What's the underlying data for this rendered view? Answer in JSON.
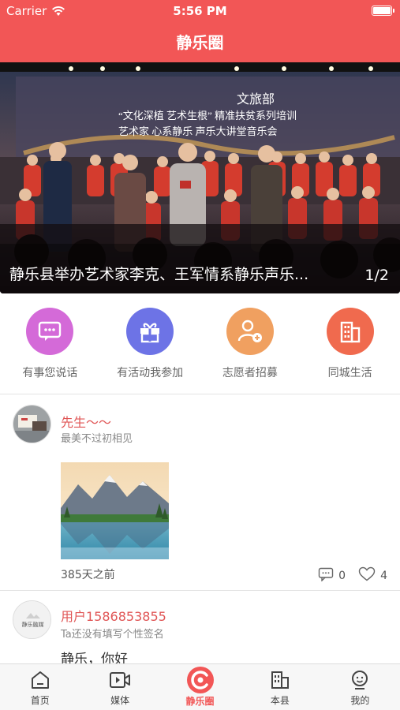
{
  "status_bar": {
    "carrier": "Carrier",
    "time": "5:56 PM"
  },
  "header": {
    "title": "静乐圈"
  },
  "banner": {
    "caption": "静乐县举办艺术家李克、王军情系静乐声乐...",
    "pager": "1/2",
    "backdrop": {
      "sign": "文旅部",
      "line1": "“文化深植  艺术生根” 精准扶贫系列培训",
      "line2": "艺术家    心系静乐    声乐大讲堂音乐会"
    }
  },
  "menu": [
    {
      "label": "有事您说话",
      "icon": "chat-icon",
      "color": "#d46ad8"
    },
    {
      "label": "有活动我参加",
      "icon": "gift-icon",
      "color": "#6d73e6"
    },
    {
      "label": "志愿者招募",
      "icon": "volunteer-icon",
      "color": "#f0a060"
    },
    {
      "label": "同城生活",
      "icon": "building-icon",
      "color": "#f06a4e"
    }
  ],
  "posts": [
    {
      "username": "先生～～",
      "signature": "最美不过初相见",
      "time_ago": "385天之前",
      "comments": "0",
      "likes": "4"
    },
    {
      "username": "用户1586853855",
      "signature": "Ta还没有填写个性签名",
      "text": "静乐，你好",
      "avatar_text": "静乐融媒"
    }
  ],
  "tabs": [
    {
      "label": "首页",
      "icon": "home-icon"
    },
    {
      "label": "媒体",
      "icon": "video-icon"
    },
    {
      "label": "静乐圈",
      "icon": "circle-icon",
      "active": true
    },
    {
      "label": "本县",
      "icon": "county-icon"
    },
    {
      "label": "我的",
      "icon": "profile-icon"
    }
  ],
  "colors": {
    "accent": "#f25656",
    "username": "#e05555"
  }
}
